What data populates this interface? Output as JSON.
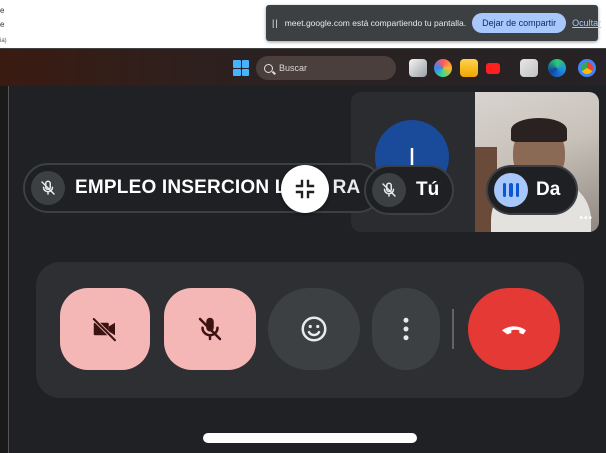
{
  "browser": {
    "edge_texts": [
      "e",
      "e",
      "S",
      "a;"
    ],
    "url_snippet": "ia)"
  },
  "share_bar": {
    "pause_glyph": "||",
    "message": "meet.google.com está compartiendo tu pantalla.",
    "stop_label": "Dejar de compartir",
    "hide_label": "Ocultar"
  },
  "taskbar": {
    "search_placeholder": "Buscar",
    "apps": [
      "file-explorer-icon",
      "copilot-icon",
      "folder-icon",
      "youtube-icon",
      "app-icon",
      "edge-icon",
      "chrome-icon"
    ]
  },
  "self_tile": {
    "avatar_initial": "I",
    "more_glyph": "•••"
  },
  "participants": {
    "main_label": "EMPLEO INSERCION L",
    "main_label_tail": "RA",
    "self_label": "Tú",
    "other_label": "Da"
  },
  "controls": {
    "camera": "camera-off",
    "microphone": "mic-off",
    "reactions": "emoji",
    "more": "more-options",
    "leave": "leave-call"
  },
  "colors": {
    "accent_blue": "#a8c7fa",
    "muted_button": "#f4b7b5",
    "end_call_red": "#e53935",
    "surface": "#2d2f33"
  }
}
